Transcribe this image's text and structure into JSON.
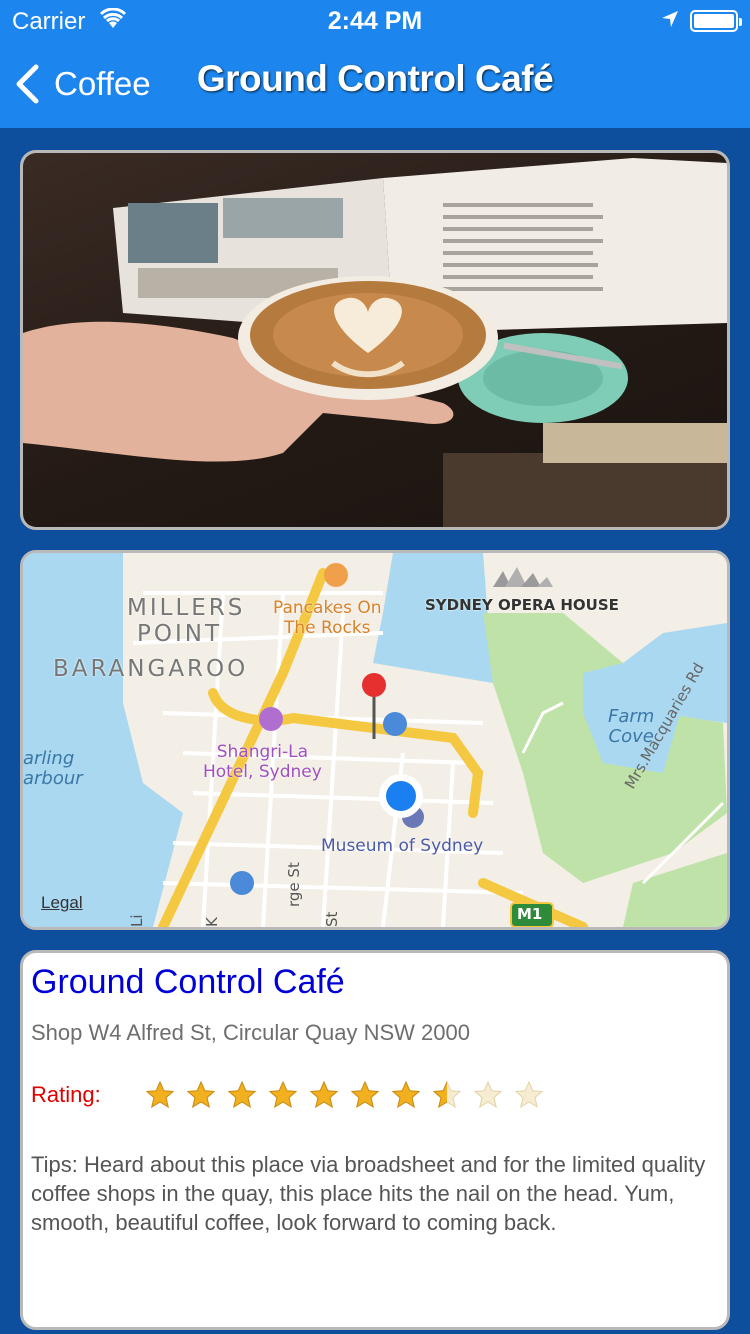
{
  "status_bar": {
    "carrier": "Carrier",
    "time": "2:44 PM"
  },
  "nav": {
    "back_label": "Coffee",
    "title": "Ground Control Café"
  },
  "map": {
    "labels": {
      "millers": "MILLERS",
      "point": "POINT",
      "barangaroo": "BARANGAROO",
      "pancakes": "Pancakes On\nThe Rocks",
      "opera": "SYDNEY OPERA HOUSE",
      "farm_cove": "Farm\nCove",
      "shangri": "Shangri-La\nHotel, Sydney",
      "museum": "Museum of Sydney",
      "darling": "arling\narbour",
      "macquaries": "Mrs.Macquaries Rd",
      "george": "rge St",
      "st": "St",
      "li": "Li",
      "k": "K",
      "m1": "M1",
      "legal": "Legal"
    }
  },
  "cafe": {
    "name": "Ground Control Café",
    "address": "Shop W4 Alfred St, Circular Quay NSW 2000",
    "rating_label": "Rating:",
    "rating": 7.5,
    "rating_max": 10,
    "tips": "Tips: Heard about this place via broadsheet and for the limited quality coffee shops in the quay, this place hits the nail on the head. Yum, smooth, beautiful coffee, look forward to coming back."
  },
  "colors": {
    "nav_bar": "#1c86ee",
    "background": "#0d4f9c",
    "cafe_name": "#0000d6",
    "rating_label": "#e00000",
    "star": "#f2b01e"
  }
}
